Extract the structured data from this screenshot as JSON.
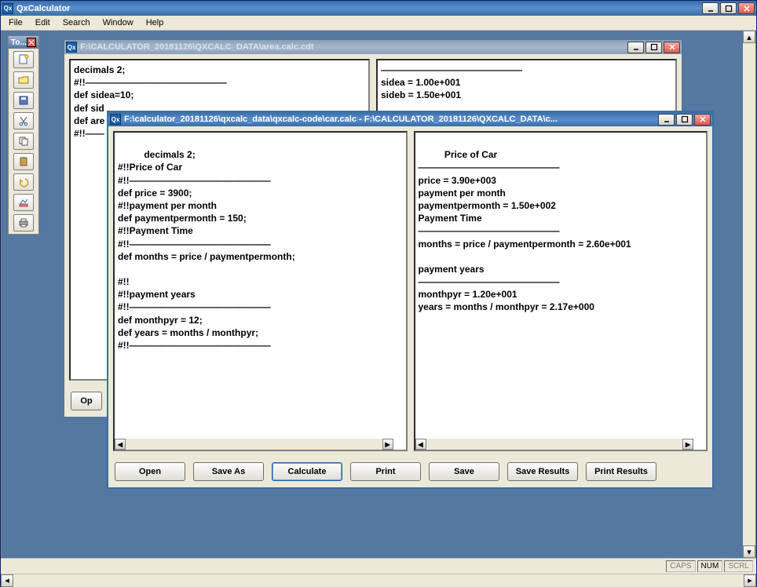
{
  "app": {
    "title": "QxCalculator"
  },
  "menu": {
    "file": "File",
    "edit": "Edit",
    "search": "Search",
    "window": "Window",
    "help": "Help"
  },
  "toolbox": {
    "title": "To..."
  },
  "child1": {
    "title": "F:\\CALCULATOR_20181126\\QXCALC_DATA\\area.calc.cdt",
    "left_text": "decimals 2;\n#!!———————————————\ndef sidea=10;\ndef sid\ndef are\n#!!——",
    "right_text": "———————————————\nsidea = 1.00e+001\nsideb = 1.50e+001",
    "buttons": {
      "open": "Op"
    }
  },
  "child2": {
    "title": "F:\\calculator_20181126\\qxcalc_data\\qxcalc-code\\car.calc - F:\\CALCULATOR_20181126\\QXCALC_DATA\\c...",
    "left_text": "decimals 2;\n#!!Price of Car\n#!!———————————————\ndef price = 3900;\n#!!payment per month\ndef paymentpermonth = 150;\n#!!Payment Time\n#!!———————————————\ndef months = price / paymentpermonth;\n\n#!!\n#!!payment years\n#!!———————————————\ndef monthpyr = 12;\ndef years = months / monthpyr;\n#!!———————————————",
    "right_text": "Price of Car\n———————————————\nprice = 3.90e+003\npayment per month\npaymentpermonth = 1.50e+002\nPayment Time\n———————————————\nmonths = price / paymentpermonth = 2.60e+001\n\npayment years\n———————————————\nmonthpyr = 1.20e+001\nyears = months / monthpyr = 2.17e+000",
    "buttons": {
      "open": "Open",
      "save_as": "Save As",
      "calculate": "Calculate",
      "print": "Print",
      "save": "Save",
      "save_results": "Save Results",
      "print_results": "Print Results"
    }
  },
  "status": {
    "caps": "CAPS",
    "num": "NUM",
    "scrl": "SCRL"
  }
}
